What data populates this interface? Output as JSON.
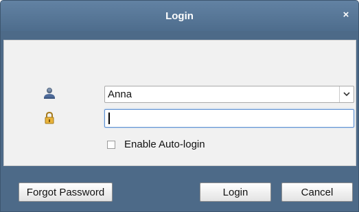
{
  "window": {
    "title": "Login",
    "close_symbol": "×"
  },
  "form": {
    "username": "Anna",
    "password": "",
    "auto_login_label": "Enable Auto-login",
    "auto_login_checked": false
  },
  "buttons": {
    "forgot_password": "Forgot Password",
    "login": "Login",
    "cancel": "Cancel"
  },
  "icons": {
    "user": "user-icon",
    "lock": "lock-icon",
    "dropdown": "chevron-down-icon"
  }
}
